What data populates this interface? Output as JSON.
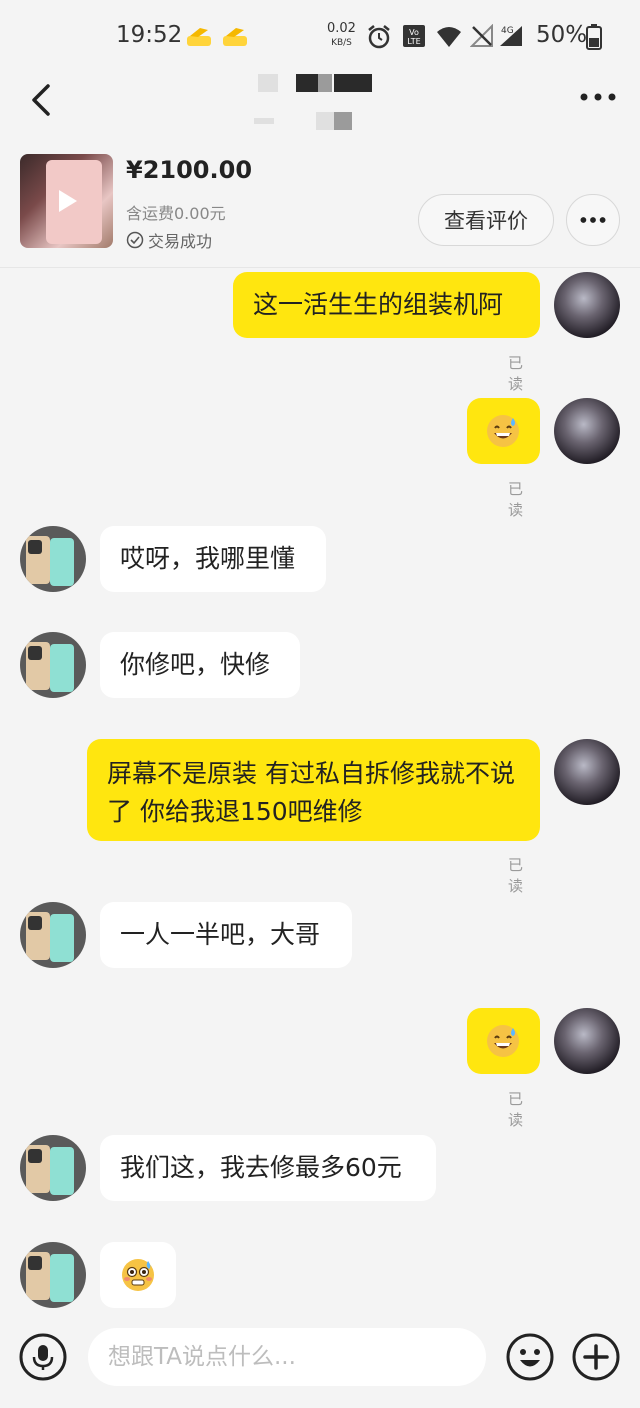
{
  "status_bar": {
    "time": "19:52",
    "net_speed": "0.02",
    "net_unit": "KB/S",
    "volte": "Vo LTE",
    "signal_4g": "4G",
    "battery": "50%"
  },
  "product": {
    "price": "¥2100.00",
    "shipping": "含运费0.00元",
    "status": "交易成功",
    "review_button": "查看评价"
  },
  "messages": [
    {
      "from": "me",
      "text": "这一活生生的组装机阿",
      "read": "已读"
    },
    {
      "from": "me",
      "emoji": "sweat-smile",
      "read": "已读"
    },
    {
      "from": "them",
      "text": "哎呀，我哪里懂"
    },
    {
      "from": "them",
      "text": "你修吧，快修"
    },
    {
      "from": "me",
      "text": "屏幕不是原装 有过私自拆修我就不说了 你给我退150吧维修",
      "read": "已读"
    },
    {
      "from": "them",
      "text": "一人一半吧，大哥"
    },
    {
      "from": "me",
      "emoji": "sweat-smile",
      "read": "已读"
    },
    {
      "from": "them",
      "text": "我们这，我去修最多60元"
    },
    {
      "from": "them",
      "emoji": "flushed-sweat"
    }
  ],
  "input": {
    "placeholder": "想跟TA说点什么..."
  },
  "colors": {
    "bubble_me": "#ffe60f",
    "bubble_them": "#ffffff",
    "background": "#f4f4f4"
  }
}
